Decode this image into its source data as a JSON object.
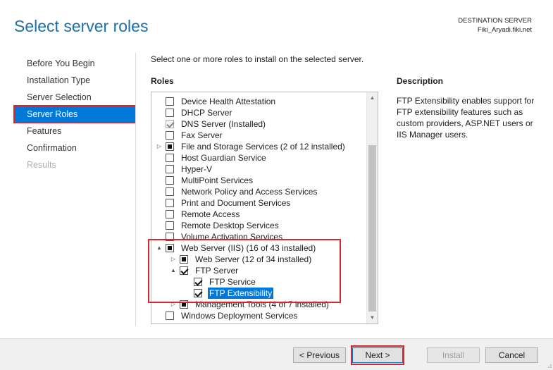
{
  "header": {
    "title": "Select server roles",
    "destination_label": "DESTINATION SERVER",
    "destination_server": "Fiki_Aryadi.fiki.net"
  },
  "nav": {
    "items": [
      {
        "label": "Before You Begin",
        "state": "normal"
      },
      {
        "label": "Installation Type",
        "state": "normal"
      },
      {
        "label": "Server Selection",
        "state": "normal"
      },
      {
        "label": "Server Roles",
        "state": "active"
      },
      {
        "label": "Features",
        "state": "normal"
      },
      {
        "label": "Confirmation",
        "state": "normal"
      },
      {
        "label": "Results",
        "state": "disabled"
      }
    ]
  },
  "main": {
    "instruction": "Select one or more roles to install on the selected server.",
    "roles_heading": "Roles",
    "description_heading": "Description",
    "description_text": "FTP Extensibility enables support for FTP extensibility features such as custom providers, ASP.NET users or IIS Manager users."
  },
  "roles": [
    {
      "label": "Device Health Attestation",
      "state": "unchecked",
      "level": 0,
      "expander": "none"
    },
    {
      "label": "DHCP Server",
      "state": "unchecked",
      "level": 0,
      "expander": "none"
    },
    {
      "label": "DNS Server (Installed)",
      "state": "checked-disabled",
      "level": 0,
      "expander": "none"
    },
    {
      "label": "Fax Server",
      "state": "unchecked",
      "level": 0,
      "expander": "none"
    },
    {
      "label": "File and Storage Services (2 of 12 installed)",
      "state": "partial",
      "level": 0,
      "expander": "collapsed"
    },
    {
      "label": "Host Guardian Service",
      "state": "unchecked",
      "level": 0,
      "expander": "none"
    },
    {
      "label": "Hyper-V",
      "state": "unchecked",
      "level": 0,
      "expander": "none"
    },
    {
      "label": "MultiPoint Services",
      "state": "unchecked",
      "level": 0,
      "expander": "none"
    },
    {
      "label": "Network Policy and Access Services",
      "state": "unchecked",
      "level": 0,
      "expander": "none"
    },
    {
      "label": "Print and Document Services",
      "state": "unchecked",
      "level": 0,
      "expander": "none"
    },
    {
      "label": "Remote Access",
      "state": "unchecked",
      "level": 0,
      "expander": "none"
    },
    {
      "label": "Remote Desktop Services",
      "state": "unchecked",
      "level": 0,
      "expander": "none"
    },
    {
      "label": "Volume Activation Services",
      "state": "unchecked",
      "level": 0,
      "expander": "none"
    },
    {
      "label": "Web Server (IIS) (16 of 43 installed)",
      "state": "partial",
      "level": 0,
      "expander": "expanded"
    },
    {
      "label": "Web Server (12 of 34 installed)",
      "state": "partial",
      "level": 1,
      "expander": "collapsed"
    },
    {
      "label": "FTP Server",
      "state": "checked",
      "level": 1,
      "expander": "expanded"
    },
    {
      "label": "FTP Service",
      "state": "checked",
      "level": 2,
      "expander": "none"
    },
    {
      "label": "FTP Extensibility",
      "state": "checked",
      "level": 2,
      "expander": "none",
      "selected": true
    },
    {
      "label": "Management Tools (4 of 7 installed)",
      "state": "partial",
      "level": 1,
      "expander": "collapsed"
    },
    {
      "label": "Windows Deployment Services",
      "state": "unchecked",
      "level": 0,
      "expander": "none"
    }
  ],
  "icons": {
    "expanded": "▲",
    "collapsed": "▷",
    "scroll_up": "▲",
    "scroll_down": "▼"
  },
  "buttons": {
    "previous": "< Previous",
    "next": "Next >",
    "install": "Install",
    "cancel": "Cancel"
  },
  "colors": {
    "accent": "#0078d7",
    "title": "#1e6fa8",
    "highlight_box": "#d7282f"
  }
}
